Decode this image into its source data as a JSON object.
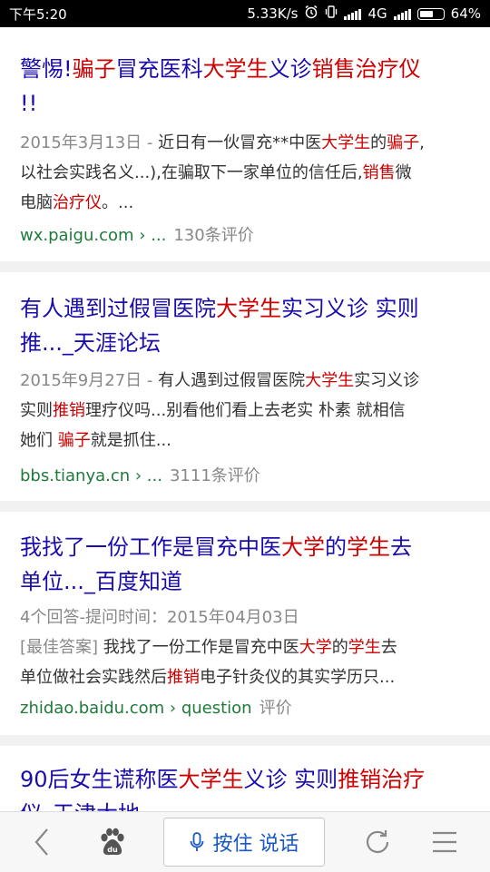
{
  "status_bar": {
    "time": "下午5:20",
    "network_speed": "5.33K/s",
    "network_type": "4G",
    "battery_percent": "64%",
    "battery_level": 0.64
  },
  "results": [
    {
      "title_parts": [
        {
          "text": "警惕!",
          "hl": false
        },
        {
          "text": "骗子",
          "hl": true
        },
        {
          "text": "冒充医科",
          "hl": false
        },
        {
          "text": "大学生",
          "hl": true
        },
        {
          "text": "义诊",
          "hl": false
        },
        {
          "text": "销售治疗仪",
          "hl": true
        }
      ],
      "title_line2": "!!",
      "date": "2015年3月13日 - ",
      "snippet_lines": [
        [
          {
            "text": "近日有一伙冒充**中医",
            "hl": false
          },
          {
            "text": "大学生",
            "hl": true
          },
          {
            "text": "的",
            "hl": false
          },
          {
            "text": "骗子",
            "hl": true
          },
          {
            "text": ",",
            "hl": false
          }
        ],
        [
          {
            "text": "以社会实践名义...),在骗取下一家单位的信任后,",
            "hl": false
          },
          {
            "text": "销售",
            "hl": true
          },
          {
            "text": "微",
            "hl": false
          }
        ],
        [
          {
            "text": "电脑",
            "hl": false
          },
          {
            "text": "治疗仪",
            "hl": true
          },
          {
            "text": "。...",
            "hl": false
          }
        ]
      ],
      "source": "wx.paigu.com › ...",
      "review_count": "130条评价"
    },
    {
      "title_parts": [
        {
          "text": "有人遇到过假冒医院",
          "hl": false
        },
        {
          "text": "大学生",
          "hl": true
        },
        {
          "text": "实习义诊 实则",
          "hl": false
        }
      ],
      "title_line2": "推..._天涯论坛",
      "date": "2015年9月27日 - ",
      "snippet_lines": [
        [
          {
            "text": "有人遇到过假冒医院",
            "hl": false
          },
          {
            "text": "大学生",
            "hl": true
          },
          {
            "text": "实习义诊",
            "hl": false
          }
        ],
        [
          {
            "text": "实则",
            "hl": false
          },
          {
            "text": "推销",
            "hl": true
          },
          {
            "text": "理疗仪吗...别看他们看上去老实 朴素 就相信",
            "hl": false
          }
        ],
        [
          {
            "text": "她们 ",
            "hl": false
          },
          {
            "text": "骗子",
            "hl": true
          },
          {
            "text": "就是抓住...",
            "hl": false
          }
        ]
      ],
      "source": "bbs.tianya.cn › ...",
      "review_count": "3111条评价"
    },
    {
      "title_parts": [
        {
          "text": "我找了一份工作是冒充中医",
          "hl": false
        },
        {
          "text": "大学",
          "hl": true
        },
        {
          "text": "的",
          "hl": false
        },
        {
          "text": "学生",
          "hl": true
        },
        {
          "text": "去",
          "hl": false
        }
      ],
      "title_line2": "单位..._百度知道",
      "meta": "4个回答-提问时间：2015年04月03日",
      "best_answer_label": "[最佳答案] ",
      "snippet_lines": [
        [
          {
            "text": "我找了一份工作是冒充中医",
            "hl": false
          },
          {
            "text": "大学",
            "hl": true
          },
          {
            "text": "的",
            "hl": false
          },
          {
            "text": "学生",
            "hl": true
          },
          {
            "text": "去",
            "hl": false
          }
        ],
        [
          {
            "text": "单位做社会实践然后",
            "hl": false
          },
          {
            "text": "推销",
            "hl": true
          },
          {
            "text": "电子针灸仪的其实学历只...",
            "hl": false
          }
        ]
      ],
      "source": "zhidao.baidu.com › question",
      "review_count": "评价"
    },
    {
      "title_parts": [
        {
          "text": "90后女生谎称医",
          "hl": false
        },
        {
          "text": "大学生",
          "hl": true
        },
        {
          "text": "义诊 实则",
          "hl": false
        },
        {
          "text": "推销治疗",
          "hl": true
        }
      ],
      "title_line2": "仪_天津大地"
    }
  ],
  "toolbar": {
    "voice_label": "按住 说话"
  },
  "colors": {
    "title_blue": "#1a0dab",
    "highlight_red": "#cc0000",
    "source_green": "#1f7a3a"
  }
}
